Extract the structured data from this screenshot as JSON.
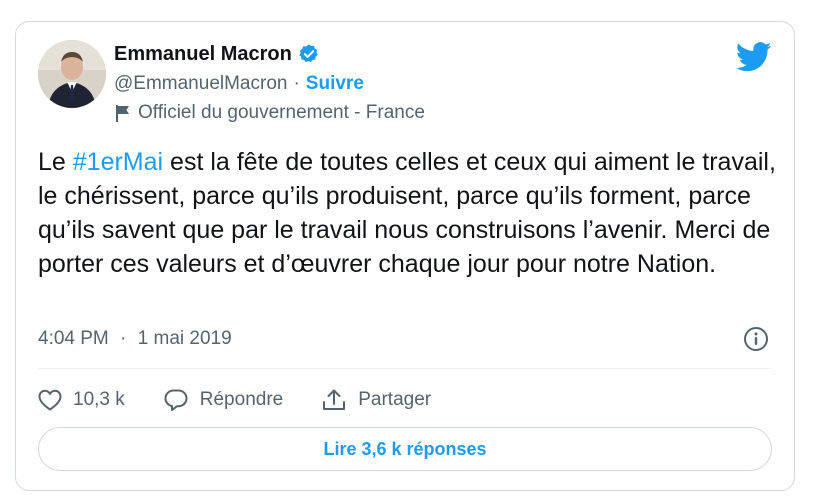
{
  "author": {
    "name": "Emmanuel Macron",
    "handle": "@EmmanuelMacron",
    "separator": "·",
    "follow_label": "Suivre",
    "account_label": "Officiel du gouvernement - France"
  },
  "tweet": {
    "text_before": "Le ",
    "hashtag": "#1erMai",
    "text_after": " est la fête de toutes celles et ceux qui aiment le travail, le chérissent, parce qu’ils produisent, parce qu’ils forment, parce qu’ils savent que par le travail nous construisons l’avenir. Merci de porter ces valeurs et d’œuvrer chaque jour pour notre Nation."
  },
  "meta": {
    "time": "4:04 PM",
    "separator": "·",
    "date": "1 mai 2019"
  },
  "actions": {
    "likes": "10,3 k",
    "reply_label": "Répondre",
    "share_label": "Partager"
  },
  "replies_button": "Lire 3,6 k réponses",
  "icons": {
    "verified": "verified-badge-icon",
    "flag": "flag-icon",
    "bird": "twitter-bird-icon",
    "info": "info-icon",
    "like": "heart-icon",
    "reply": "speech-bubble-icon",
    "share": "share-upload-icon"
  },
  "colors": {
    "accent": "#1d9bf0",
    "text": "#0f1419",
    "muted": "#536471",
    "border": "#cfd9de"
  }
}
